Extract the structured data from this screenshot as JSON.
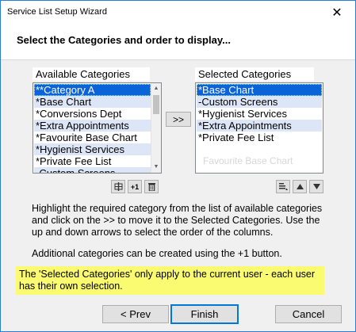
{
  "window": {
    "title": "Service List Setup Wizard",
    "close_glyph": "✕"
  },
  "header": {
    "heading": "Select the Categories and order to display..."
  },
  "available": {
    "label": "Available Categories",
    "items": [
      "**Category A",
      "*Base Chart",
      "*Conversions Dept",
      "*Extra Appointments",
      "*Favourite Base Chart",
      "*Hygienist Services",
      "*Private Fee List",
      "-Custom Screens"
    ],
    "selected_index": 0
  },
  "selected": {
    "label": "Selected Categories",
    "items": [
      "*Base Chart",
      "-Custom Screens",
      "*Hygienist Services",
      "*Extra Appointments",
      "*Private Fee List"
    ],
    "selected_index": 0,
    "ghost_text": "Favourite Base Chart"
  },
  "buttons": {
    "move_label": ">>",
    "add_label": "+1",
    "prev_label": "< Prev",
    "finish_label": "Finish",
    "cancel_label": "Cancel"
  },
  "instructions": {
    "text": "Highlight the required category from the list of available categories and click on the >> to move it to the Selected Categories. Use the up and down arrows to select the order of the columns.",
    "additional": "Additional categories can be created using the +1 button."
  },
  "note": {
    "text": "The 'Selected Categories' only apply to the current user - each user has their own selection."
  },
  "colors": {
    "selection": "#0a63d8",
    "alt_row": "#dde6f7",
    "note_bg": "#fbfb72"
  }
}
